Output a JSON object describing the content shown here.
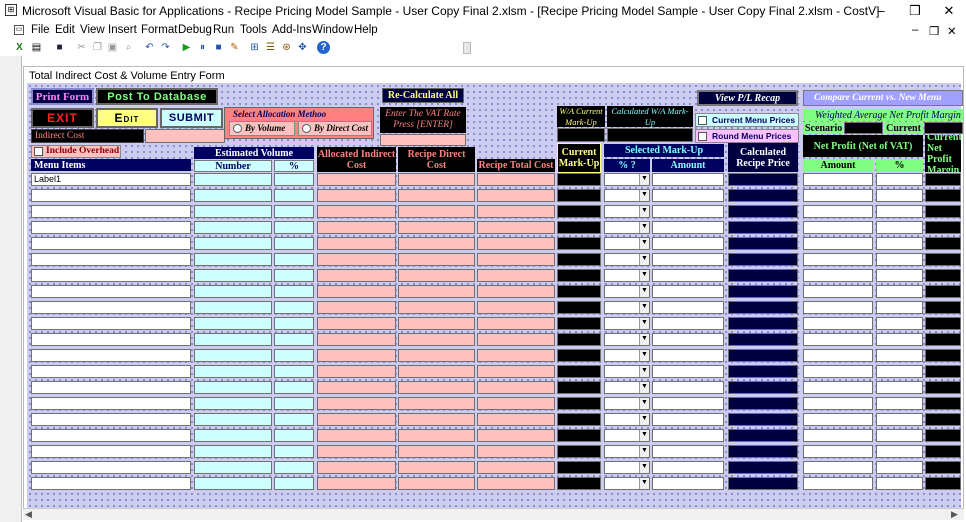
{
  "titlebar": {
    "title": "Microsoft Visual Basic for Applications - Recipe Pricing Model Sample - User Copy Final 2.xlsm - [Recipe Pricing Model Sample - User Copy Final 2.xlsm - CostV]",
    "minimize": "–",
    "restore": "❒",
    "close": "✕"
  },
  "menubar": {
    "items": [
      "File",
      "Edit",
      "View",
      "Insert",
      "Format",
      "Debug",
      "Run",
      "Tools",
      "Add-Ins",
      "Window",
      "Help"
    ],
    "doc_minimize": "–",
    "doc_restore": "❒",
    "doc_close": "✕"
  },
  "form": {
    "caption": "Total Indirect Cost & Volume Entry Form",
    "print_form": "Print Form",
    "post_to_database": "Post To Database",
    "exit": "EXIT",
    "edit": "Edit",
    "submit": "SUBMIT",
    "recalculate_all": "Re-Calculate All",
    "view_pl_recap": "View P/L Recap",
    "compare": "Compare Current vs. New Menu",
    "indirect_cost_label": "Indirect Cost",
    "include_overhead": "Include Overhead",
    "allocation_method_label": "Select Allocation Methoo",
    "by_volume": "By Volume",
    "by_direct_cost": "By Direct Cost",
    "vat_label": "Enter The VAT Rate Press [ENTER]",
    "wa_current_markup": "W/A Current Mark-Up",
    "calculated_wa_markup": "Calculated W/A Mark-Up",
    "current_menu_prices": "Current Menu Prices",
    "round_menu_prices": "Round Menu Prices",
    "weighted_avg_profit": "Weighted Average Net Profit Margin",
    "scenario": "Scenario",
    "current": "Current",
    "menu_items": "Menu Items",
    "estimated_volume": "Estimated  Volume",
    "number": "Number",
    "percent": "%",
    "allocated_indirect_cost": "Allocated Indirect Cost",
    "recipe_direct_cost": "Recipe Direct Cost",
    "recipe_total_cost": "Recipe Total Cost",
    "current_markup": "Current Mark-Up",
    "selected_markup": "Selected Mark-Up",
    "markup_pct": "%  ?",
    "amount": "Amount",
    "calculated_recipe_price": "Calculated Recipe Price",
    "net_profit": "Net Profit (Net of VAT)",
    "net_amount": "Amount",
    "net_pct": "%",
    "current_net_profit": "Current Net Profit Margin",
    "first_row_label": "Label1",
    "row_count": 20
  },
  "colors": {
    "client_bg": "#ccccf0",
    "cyan_field": "#ccffff",
    "pink_field": "#ffc0c0",
    "navy": "#000040",
    "green_header": "#80ff80"
  }
}
